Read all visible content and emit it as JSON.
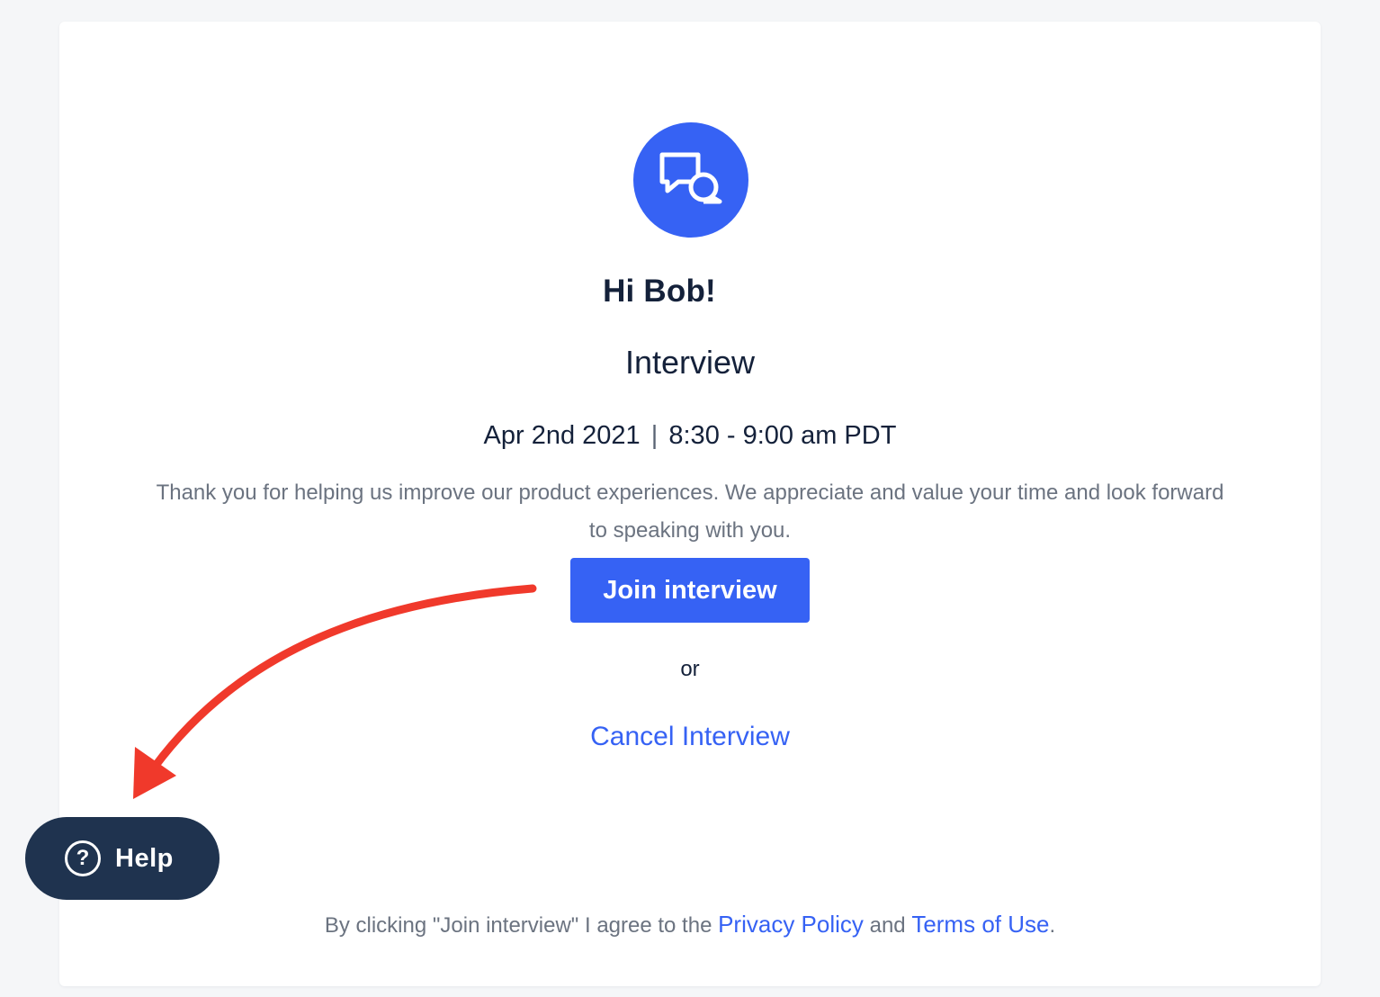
{
  "card": {
    "greeting": "Hi Bob!",
    "title": "Interview",
    "date": "Apr 2nd 2021",
    "separator": "|",
    "time": "8:30 - 9:00 am PDT",
    "message": "Thank you for helping us improve our product experiences. We appreciate and value your time and look forward to speaking with you.",
    "join_label": "Join interview",
    "or_text": "or",
    "cancel_label": "Cancel Interview",
    "legal": {
      "prefix": "By clicking \"Join interview\" I agree to the ",
      "privacy_label": "Privacy Policy",
      "middle": " and ",
      "terms_label": "Terms of Use",
      "suffix": "."
    },
    "avatar_icon": "chat-bubbles-icon"
  },
  "help": {
    "label": "Help",
    "icon_glyph": "?",
    "icon": "question-circle-icon"
  },
  "annotation": {
    "arrow_color": "#f0392b",
    "icon": "curved-arrow-icon"
  },
  "colors": {
    "accent": "#3662f4",
    "text_dark": "#14213a",
    "text_muted": "#6b7380",
    "help_bg": "#1f334f",
    "page_bg": "#f5f6f8"
  }
}
